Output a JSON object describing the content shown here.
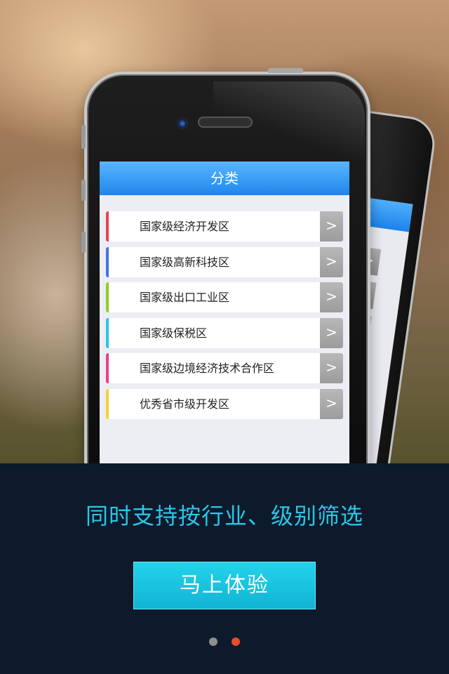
{
  "category_screen": {
    "title": "分类",
    "items": [
      {
        "label": "国家级经济开发区",
        "color": "#e8414e"
      },
      {
        "label": "国家级高新科技区",
        "color": "#4a6fe8"
      },
      {
        "label": "国家级出口工业区",
        "color": "#8ed01b"
      },
      {
        "label": "国家级保税区",
        "color": "#2cc4e6"
      },
      {
        "label": "国家级边境经济技术合作区",
        "color": "#ea3f8a"
      },
      {
        "label": "优秀省市级开发区",
        "color": "#f3d238"
      }
    ],
    "arrow_glyph": ">"
  },
  "back_phone": {
    "arrow_glyph": ">"
  },
  "promo": {
    "tagline": "同时支持按行业、级别筛选",
    "cta_label": "马上体验"
  },
  "pager": {
    "page_count": 2,
    "active_index": 1,
    "colors": {
      "active": "#ea4a2c",
      "inactive": "#8f8f8f"
    }
  },
  "colors": {
    "accent": "#2cc6e6",
    "header_blue": "#1f85ea",
    "panel_bg": "#0c1a2c"
  }
}
